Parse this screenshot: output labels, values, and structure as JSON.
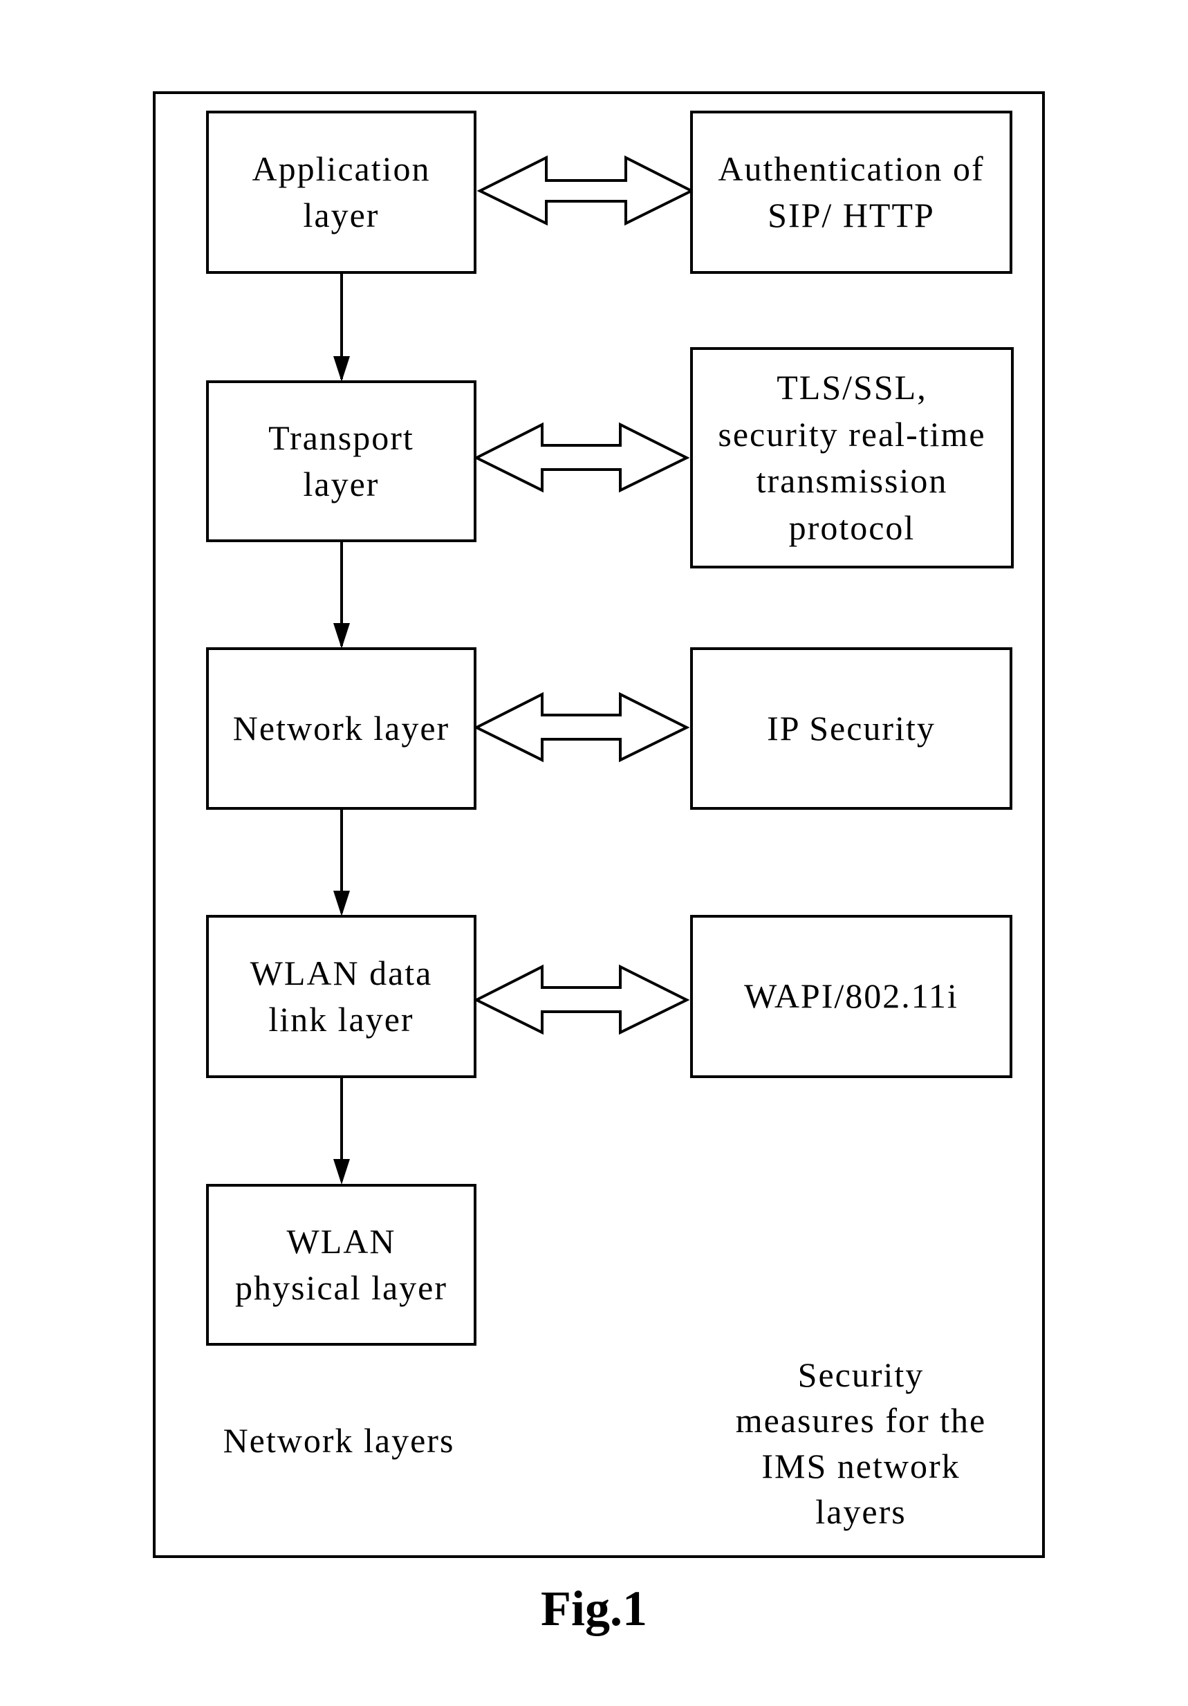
{
  "network_layers": [
    {
      "label": "Application\nlayer"
    },
    {
      "label": "Transport\nlayer"
    },
    {
      "label": "Network layer"
    },
    {
      "label": "WLAN data\nlink layer"
    },
    {
      "label": "WLAN\nphysical layer"
    }
  ],
  "security_measures": [
    {
      "label": "Authentication of\nSIP/ HTTP"
    },
    {
      "label": "TLS/SSL,\nsecurity real-time\ntransmission\nprotocol"
    },
    {
      "label": "IP Security"
    },
    {
      "label": "WAPI/802.11i"
    }
  ],
  "captions": {
    "left": "Network layers",
    "right": "Security\nmeasures for the\nIMS network\nlayers"
  },
  "figure_label": "Fig.1"
}
